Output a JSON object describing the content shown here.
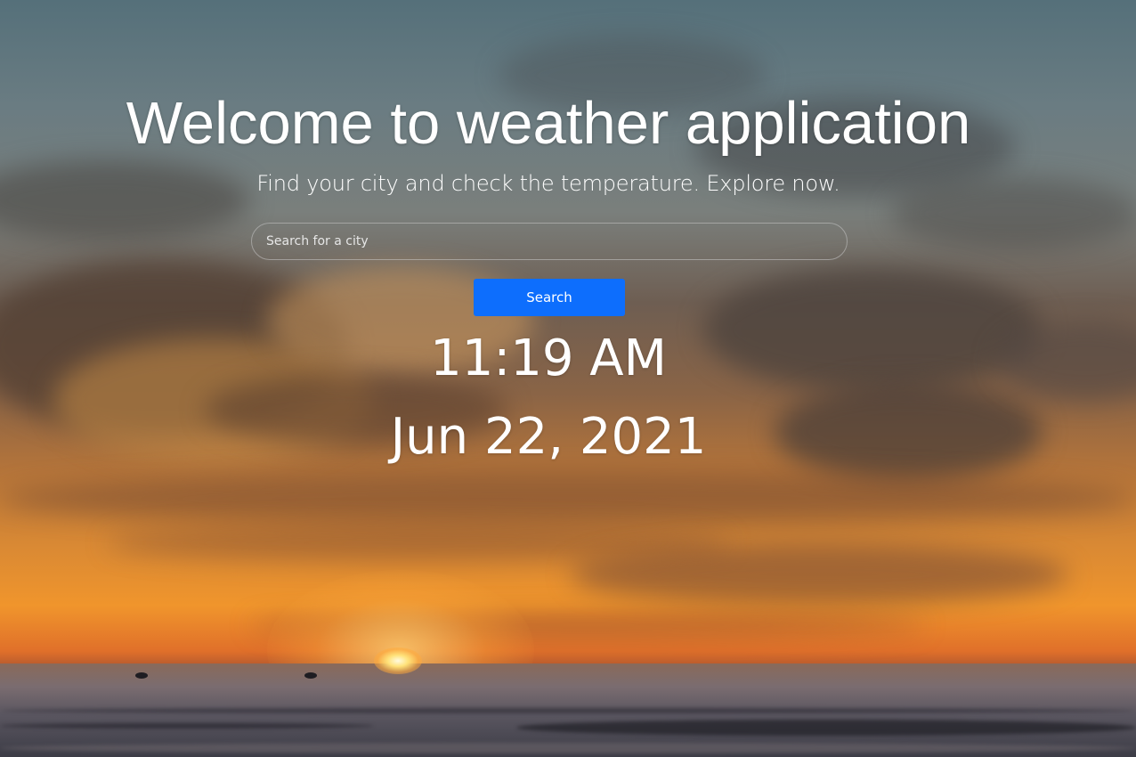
{
  "hero": {
    "title": "Welcome to weather application",
    "subtitle": "Find your city and check the temperature. Explore now."
  },
  "search": {
    "placeholder": "Search for a city",
    "value": "",
    "button_label": "Search"
  },
  "clock": {
    "time": "11:19 AM",
    "date": "Jun 22, 2021"
  },
  "background": {
    "scene": "sunset over the sea",
    "colors": {
      "sky_top": "#55707a",
      "sunset_glow": "#f0952c",
      "sea": "#5a5660"
    }
  },
  "colors": {
    "text": "#ffffff",
    "accent_button": "#0d6efd"
  }
}
